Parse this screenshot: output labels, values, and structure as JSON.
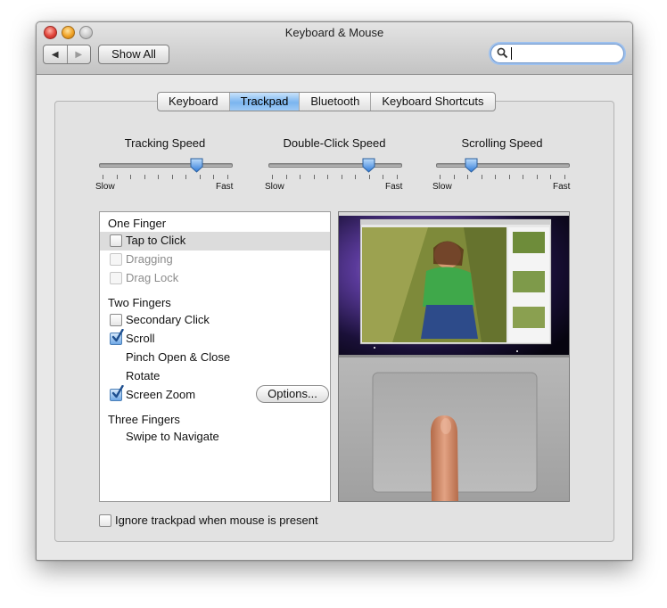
{
  "window": {
    "title": "Keyboard & Mouse",
    "back_icon": "back-arrow-icon",
    "forward_icon": "forward-arrow-icon",
    "back_glyph": "◀",
    "forward_glyph": "▶",
    "show_all_label": "Show All",
    "search": {
      "value": "",
      "icon": "search-icon"
    }
  },
  "tabs": [
    {
      "label": "Keyboard",
      "selected": false
    },
    {
      "label": "Trackpad",
      "selected": true
    },
    {
      "label": "Bluetooth",
      "selected": false
    },
    {
      "label": "Keyboard Shortcuts",
      "selected": false
    }
  ],
  "sliders": [
    {
      "title": "Tracking Speed",
      "min_label": "Slow",
      "max_label": "Fast",
      "value": 0.75
    },
    {
      "title": "Double-Click Speed",
      "min_label": "Slow",
      "max_label": "Fast",
      "value": 0.77
    },
    {
      "title": "Scrolling Speed",
      "min_label": "Slow",
      "max_label": "Fast",
      "value": 0.25
    }
  ],
  "gestures": {
    "one_finger": {
      "header": "One Finger",
      "items": [
        {
          "label": "Tap to Click",
          "checked": false,
          "enabled": true,
          "selected": true
        },
        {
          "label": "Dragging",
          "checked": false,
          "enabled": false
        },
        {
          "label": "Drag Lock",
          "checked": false,
          "enabled": false
        }
      ]
    },
    "two_fingers": {
      "header": "Two Fingers",
      "items": [
        {
          "label": "Secondary Click",
          "checked": false
        },
        {
          "label": "Scroll",
          "checked": true
        },
        {
          "label": "Pinch Open & Close"
        },
        {
          "label": "Rotate"
        },
        {
          "label": "Screen Zoom",
          "checked": true
        }
      ],
      "options_label": "Options..."
    },
    "three_fingers": {
      "header": "Three Fingers",
      "items": [
        {
          "label": "Swipe to Navigate"
        }
      ]
    }
  },
  "preview": {
    "image": "trackpad-demo-video"
  },
  "ignore_trackpad": {
    "label": "Ignore trackpad when mouse is present",
    "checked": false
  },
  "colors": {
    "selection_blue": "#7bb5ef",
    "check_blue": "#2e6bb3"
  }
}
